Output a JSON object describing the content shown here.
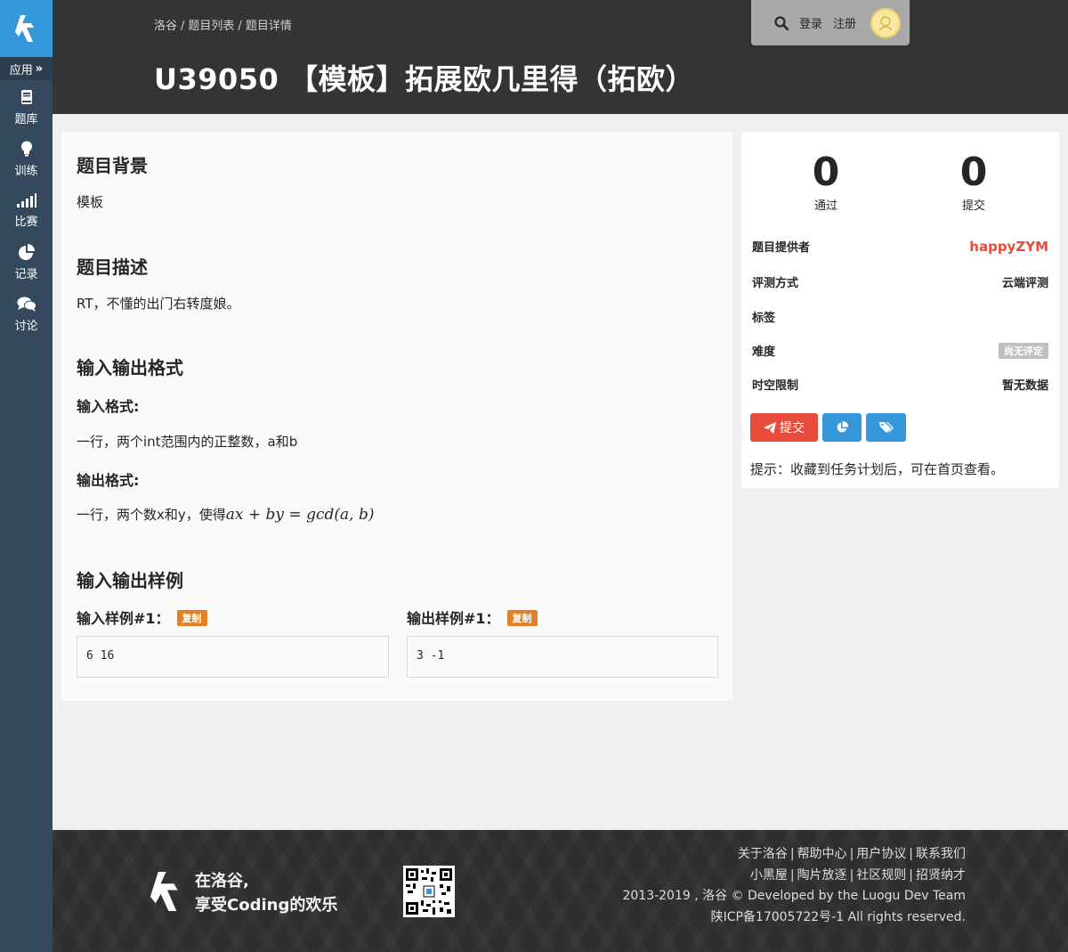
{
  "sidebar": {
    "apps_label": "应用",
    "items": [
      {
        "label": "题库",
        "icon": "book-icon"
      },
      {
        "label": "训练",
        "icon": "lightbulb-icon"
      },
      {
        "label": "比赛",
        "icon": "signal-bars-icon"
      },
      {
        "label": "记录",
        "icon": "pie-chart-icon"
      },
      {
        "label": "讨论",
        "icon": "comments-icon"
      }
    ]
  },
  "header": {
    "breadcrumb": [
      "洛谷",
      "题目列表",
      "题目详情"
    ],
    "title": "U39050 【模板】拓展欧几里得（拓欧）",
    "login": "登录",
    "register": "注册"
  },
  "problem": {
    "background_title": "题目背景",
    "background_text": "模板",
    "description_title": "题目描述",
    "description_text": "RT，不懂的出门右转度娘。",
    "io_title": "输入输出格式",
    "input_format_title": "输入格式:",
    "input_format_text": "一行，两个int范围内的正整数，a和b",
    "output_format_title": "输出格式:",
    "output_format_text": "一行，两个数x和y，使得",
    "output_formula": "ax + by = gcd(a, b)",
    "samples_title": "输入输出样例",
    "input_sample_title": "输入样例#1：",
    "output_sample_title": "输出样例#1：",
    "copy_label": "复制",
    "input_sample": "6 16",
    "output_sample": "3 -1"
  },
  "stats": {
    "passed": "0",
    "passed_label": "通过",
    "submitted": "0",
    "submitted_label": "提交"
  },
  "info": {
    "provider_label": "题目提供者",
    "provider": "happyZYM",
    "judge_label": "评测方式",
    "judge": "云端评测",
    "tags_label": "标签",
    "difficulty_label": "难度",
    "difficulty": "尚无评定",
    "limits_label": "时空限制",
    "limits": "暂无数据"
  },
  "actions": {
    "submit_label": "提交"
  },
  "hint": "提示：收藏到任务计划后，可在首页查看。",
  "footer": {
    "slogan_line1": "在洛谷,",
    "slogan_line2": "享受Coding的欢乐",
    "links_row1": [
      "关于洛谷",
      "帮助中心",
      "用户协议",
      "联系我们"
    ],
    "links_row2": [
      "小黑屋",
      "陶片放逐",
      "社区规则",
      "招贤纳才"
    ],
    "copyright": "2013-2019 , 洛谷 © Developed by the Luogu Dev Team",
    "icp": "陕ICP备17005722号-1 All rights reserved."
  },
  "colors": {
    "sidebar": "#34495e",
    "logo_bg": "#3498db",
    "header": "#343434",
    "accent_red": "#e74c3c",
    "accent_blue": "#3498db",
    "copy_badge": "#e67e22"
  }
}
